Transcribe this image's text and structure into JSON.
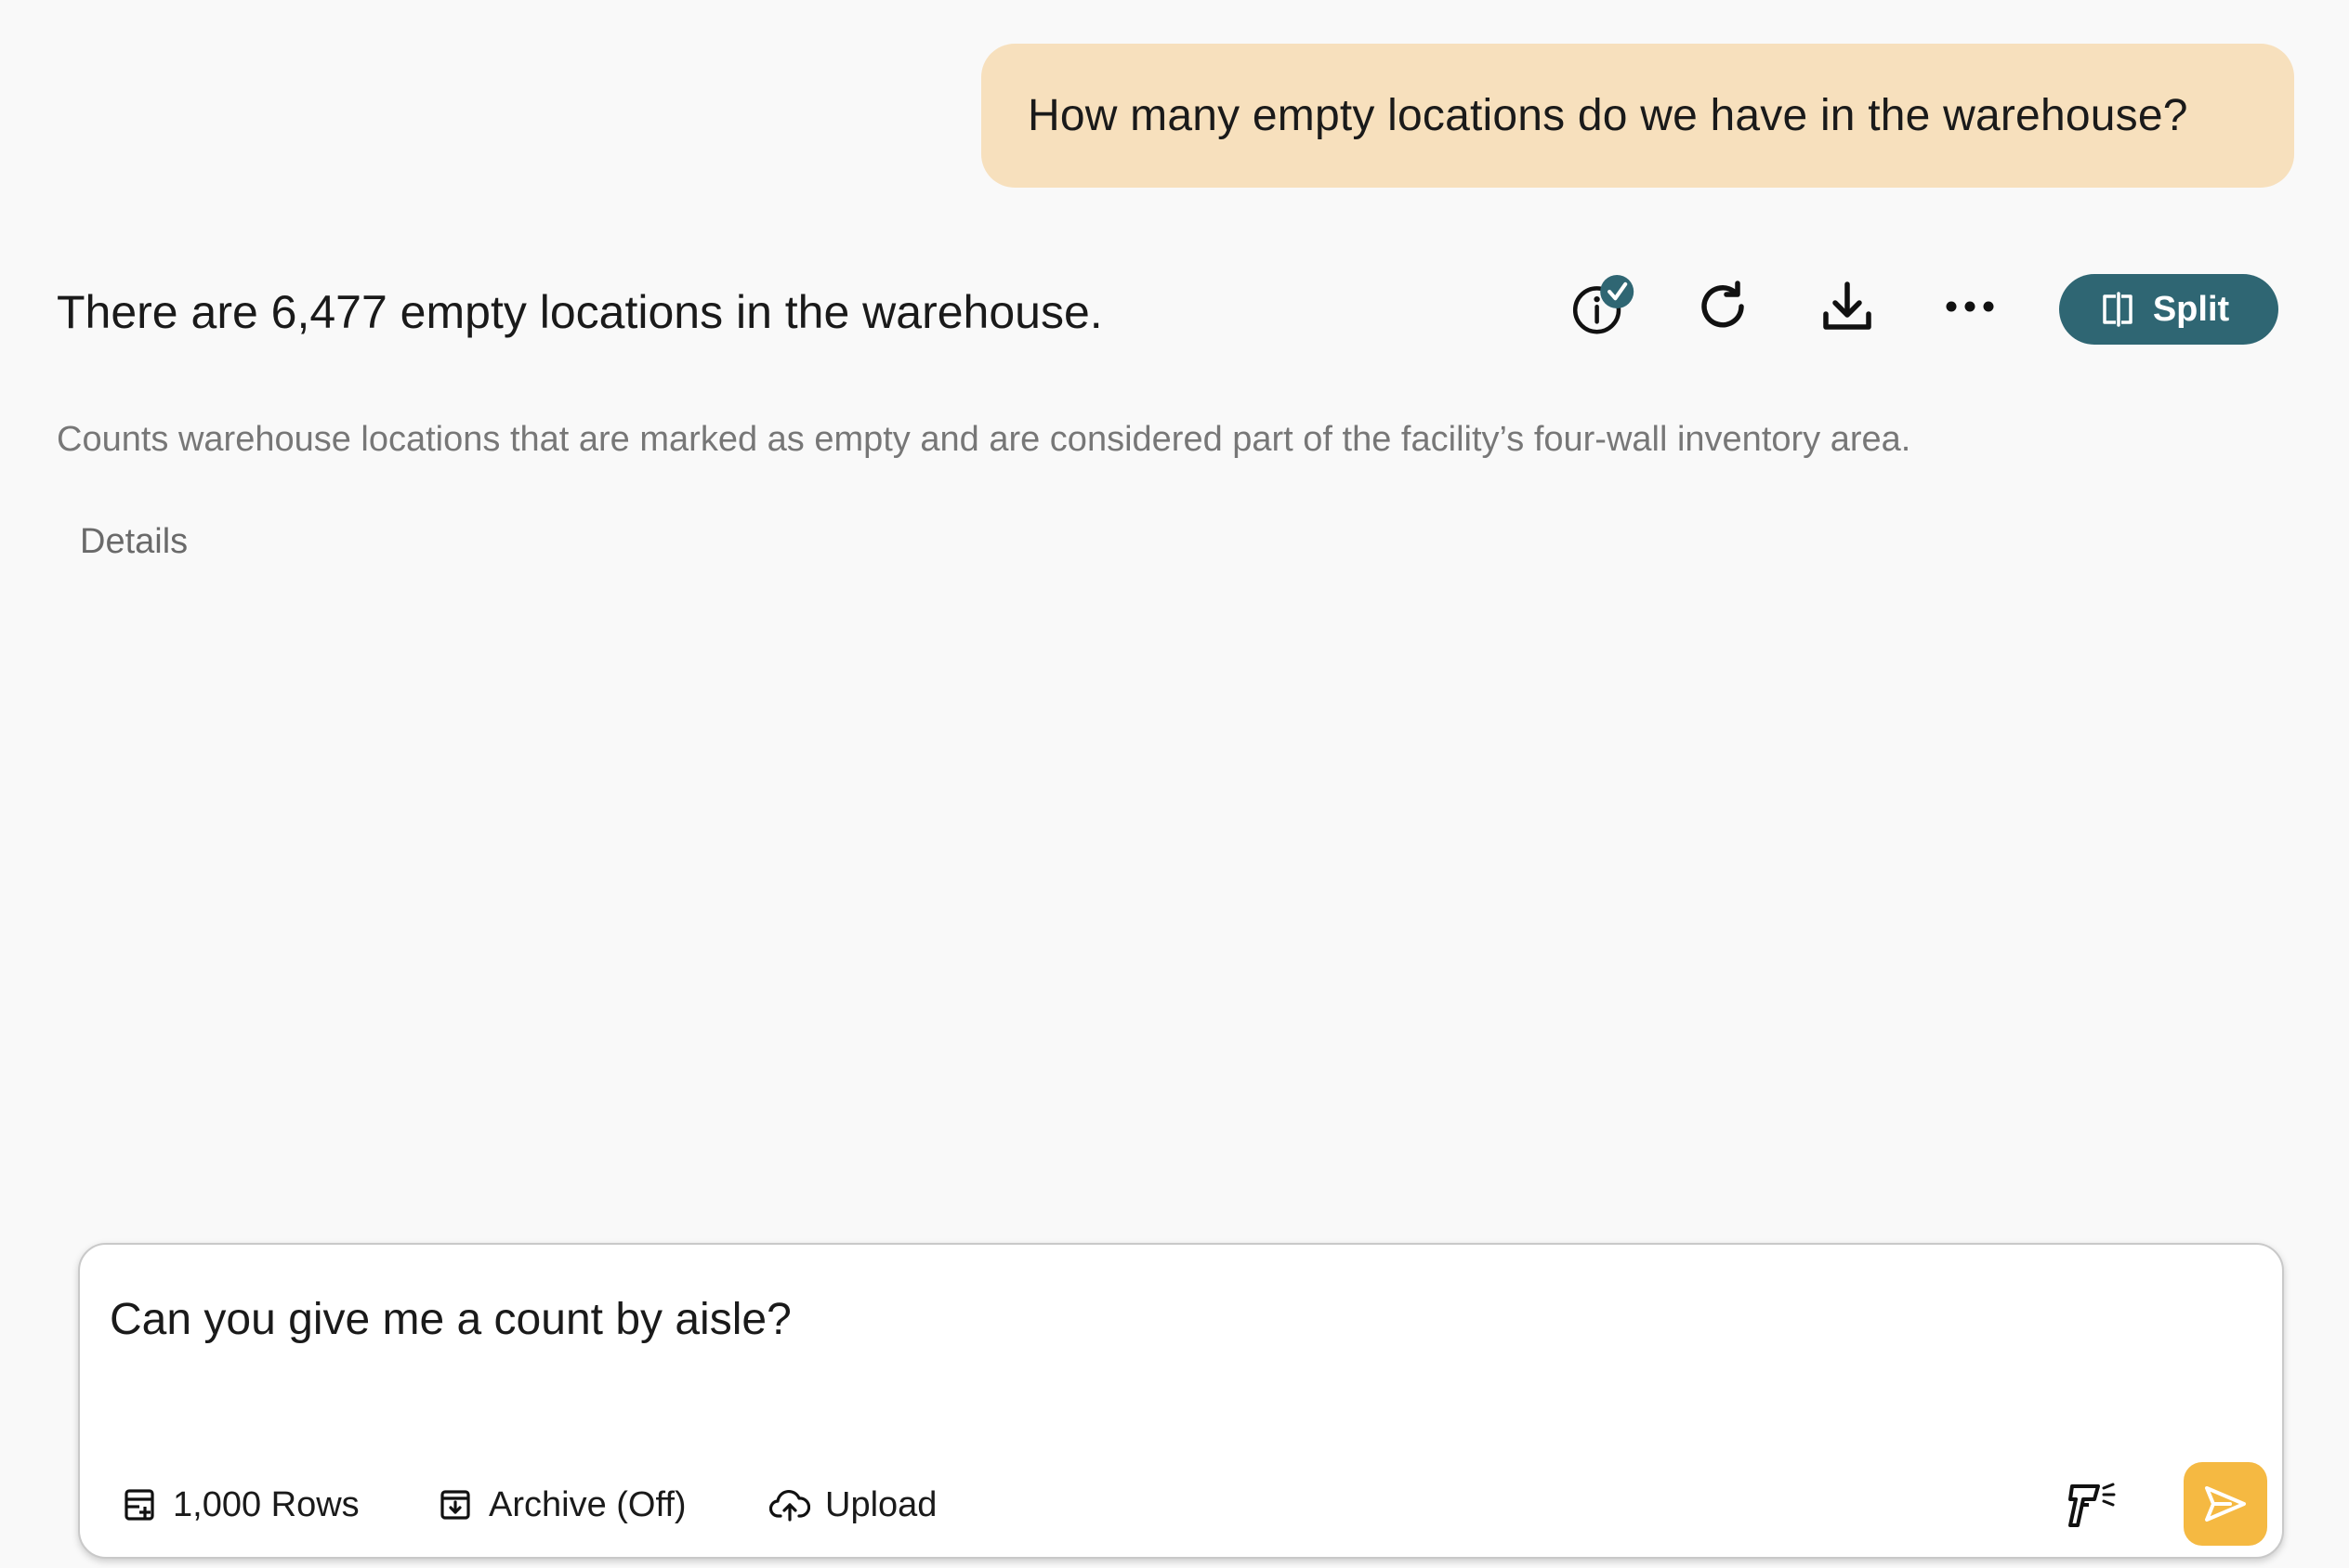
{
  "conversation": {
    "user_message": "How many empty locations do we have in the warehouse?",
    "answer": "There are 6,477 empty locations in the warehouse.",
    "description": "Counts warehouse locations that are marked as empty and are considered part of the facility’s four-wall inventory area.",
    "details_label": "Details"
  },
  "toolbar": {
    "icons": [
      "info-verified-icon",
      "refresh-icon",
      "download-icon",
      "more-icon"
    ],
    "split_label": "Split"
  },
  "composer": {
    "input_value": "Can you give me a count by aisle?",
    "rows_label": "1,000 Rows",
    "archive_label": "Archive (Off)",
    "upload_label": "Upload",
    "send_icon": "send-icon",
    "voice_icon": "voice-input-icon"
  },
  "colors": {
    "user_bubble": "#f7e0bd",
    "accent_teal": "#2f6673",
    "send_button": "#f5b942",
    "background": "#f9f9f9"
  }
}
